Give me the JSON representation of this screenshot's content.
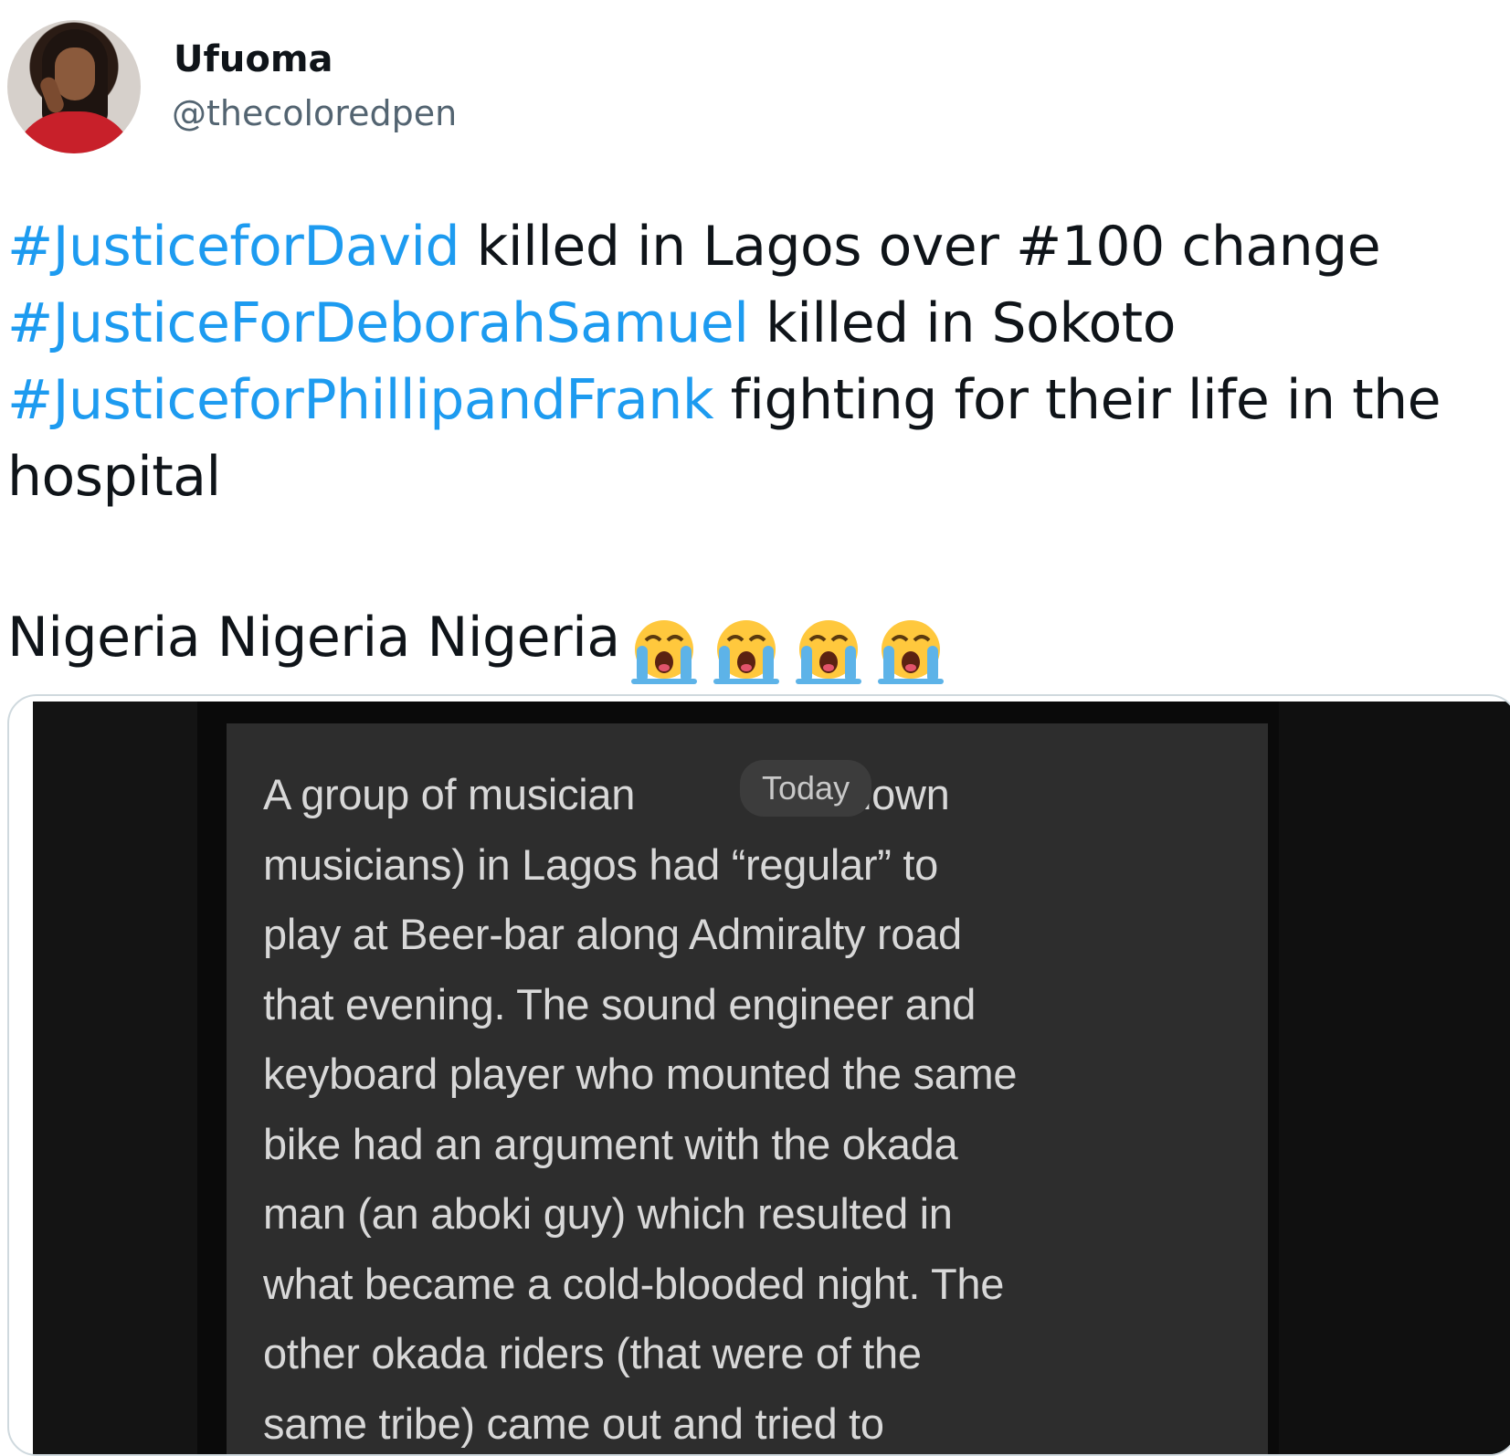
{
  "author": {
    "name": "Ufuoma",
    "handle": "@thecoloredpen"
  },
  "tweet": {
    "lines": [
      {
        "hashtag": "#JusticeforDavid",
        "text": " killed in Lagos over #100 change"
      },
      {
        "hashtag": "#JusticeForDeborahSamuel",
        "text": " killed in Sokoto"
      },
      {
        "hashtag": "#JusticeforPhillipandFrank",
        "text": " fighting for their life in the"
      },
      {
        "hashtag": "",
        "text": "hospital"
      }
    ],
    "closing": "Nigeria Nigeria Nigeria",
    "emojis": [
      "loudly-crying-face",
      "loudly-crying-face",
      "loudly-crying-face",
      "loudly-crying-face"
    ]
  },
  "media": {
    "date_pill": "Today",
    "lines": [
      "A group of musician",
      "musicians) in Lagos had “regular” to",
      "play at Beer-bar along Admiralty road",
      "that evening. The sound engineer and",
      "keyboard player who mounted the same",
      "bike had an argument with the okada",
      "man (an aboki guy) which resulted in",
      "what became a cold-blooded night. The",
      "other okada riders (that were of the",
      "same tribe) came out and tried to"
    ],
    "line1_tail": "known"
  },
  "colors": {
    "hashtag": "#1d9bf0",
    "text": "#0f1419",
    "secondary": "#536471"
  }
}
